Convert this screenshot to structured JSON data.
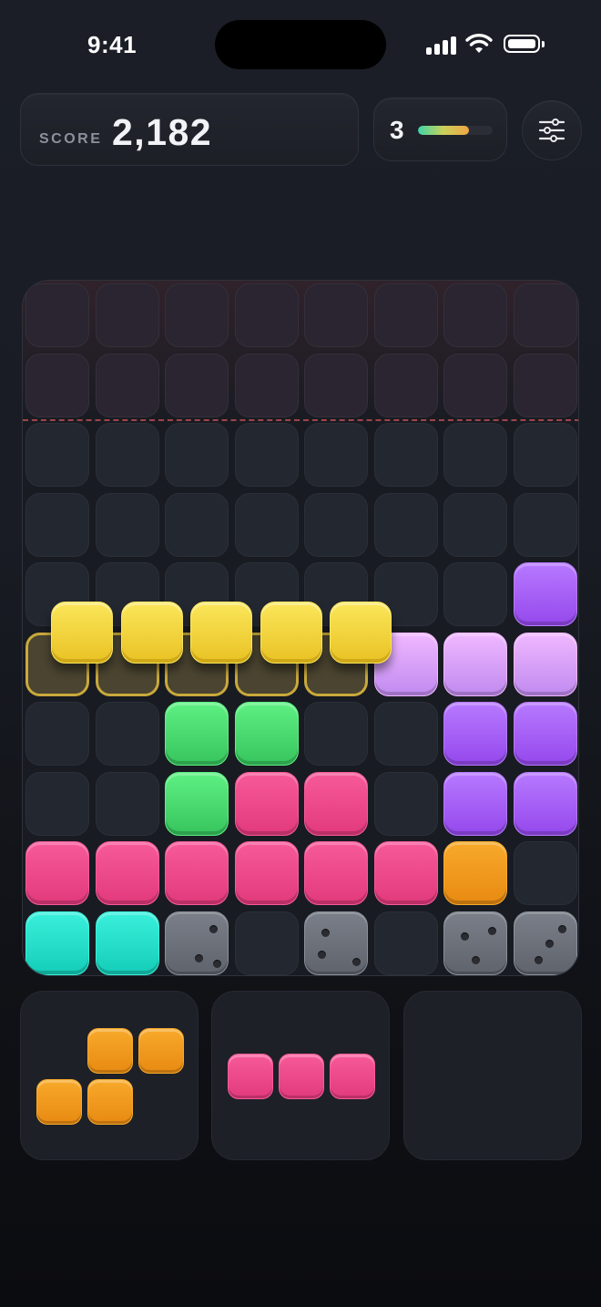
{
  "status_bar": {
    "time": "9:41"
  },
  "score": {
    "label": "SCORE",
    "value": "2,182"
  },
  "level": {
    "number": "3",
    "progress": 0.68
  },
  "settings": {
    "icon": "sliders-icon"
  },
  "colors": {
    "yellow": "#f3d33c",
    "purple": "#a35ff2",
    "lilac": "#d49df5",
    "green": "#4fdd72",
    "pink": "#ee4a8a",
    "orange": "#f19a1c",
    "teal": "#27dfcb",
    "danger_line": "#b84a52"
  },
  "board": {
    "columns": 8,
    "rows": 10,
    "danger_rows": 2,
    "grid": [
      "........",
      "........",
      "........",
      "........",
      ".......P",
      "GGGGGLLL",
      "..EE..PP",
      "..EKK.PP",
      "KKKKKKO.",
      "TTS.S.SS"
    ],
    "legend": {
      ".": "empty",
      "P": "purple",
      "L": "lilac",
      "E": "green",
      "K": "pink",
      "O": "orange",
      "T": "teal",
      "S": "stone",
      "G": "placement-preview"
    },
    "dragging_piece": {
      "color": "yellow",
      "cells": [
        [
          5,
          0
        ],
        [
          5,
          1
        ],
        [
          5,
          2
        ],
        [
          5,
          3
        ],
        [
          5,
          4
        ]
      ]
    }
  },
  "tray": [
    {
      "color": "orange",
      "cells": [
        [
          0,
          1
        ],
        [
          0,
          2
        ],
        [
          1,
          0
        ],
        [
          1,
          1
        ]
      ]
    },
    {
      "color": "pink",
      "cells": [
        [
          0,
          0
        ],
        [
          0,
          1
        ],
        [
          0,
          2
        ]
      ]
    },
    {
      "color": null,
      "cells": []
    }
  ]
}
